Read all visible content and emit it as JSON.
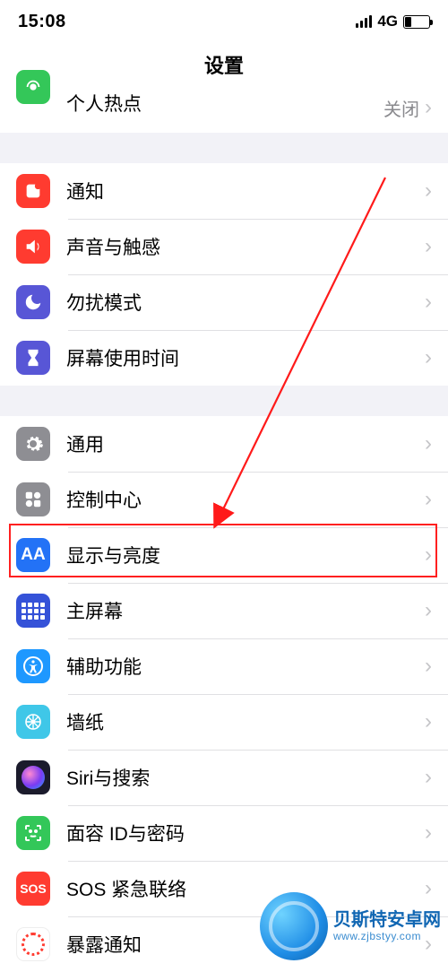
{
  "status": {
    "time": "15:08",
    "network": "4G"
  },
  "title": "设置",
  "groups": [
    {
      "rows": [
        {
          "key": "hotspot",
          "label": "个人热点",
          "value": "关闭"
        }
      ]
    },
    {
      "rows": [
        {
          "key": "notifications",
          "label": "通知"
        },
        {
          "key": "sounds",
          "label": "声音与触感"
        },
        {
          "key": "dnd",
          "label": "勿扰模式"
        },
        {
          "key": "screentime",
          "label": "屏幕使用时间"
        }
      ]
    },
    {
      "rows": [
        {
          "key": "general",
          "label": "通用"
        },
        {
          "key": "controlcenter",
          "label": "控制中心"
        },
        {
          "key": "display",
          "label": "显示与亮度"
        },
        {
          "key": "homescreen",
          "label": "主屏幕"
        },
        {
          "key": "accessibility",
          "label": "辅助功能"
        },
        {
          "key": "wallpaper",
          "label": "墙纸"
        },
        {
          "key": "siri",
          "label": "Siri与搜索"
        },
        {
          "key": "faceid",
          "label": "面容 ID与密码"
        },
        {
          "key": "sos",
          "label": "SOS 紧急联络"
        },
        {
          "key": "exposure",
          "label": "暴露通知"
        }
      ]
    }
  ],
  "annotation": {
    "highlighted_row": "display"
  },
  "watermark": {
    "cn": "贝斯特安卓网",
    "url": "www.zjbstyy.com"
  }
}
